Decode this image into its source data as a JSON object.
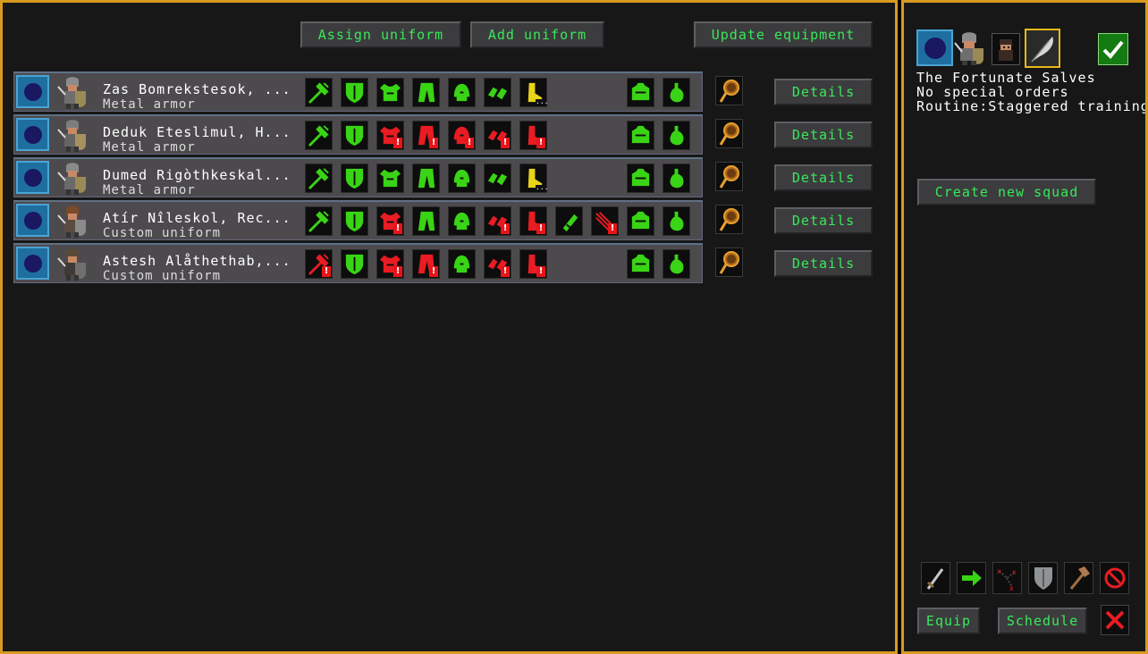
{
  "toolbar": {
    "assign_label": "Assign uniform",
    "add_label": "Add uniform",
    "update_label": "Update equipment"
  },
  "soldiers": [
    {
      "name": "Zas Bomrekstesok, ...",
      "uniform": "Metal armor",
      "details_label": "Details",
      "slots": [
        "weapon-ok",
        "shield-ok",
        "armor-ok",
        "legs-ok",
        "helm-ok",
        "gloves-ok",
        "boots-partial",
        "",
        "",
        "armor-ok",
        "flask-ok"
      ]
    },
    {
      "name": "Deduk Eteslimul, H...",
      "uniform": "Metal armor",
      "details_label": "Details",
      "slots": [
        "weapon-ok",
        "shield-ok",
        "armor-missing",
        "legs-missing",
        "helm-missing",
        "gloves-missing",
        "boots-missing",
        "",
        "",
        "armor-ok",
        "flask-ok"
      ]
    },
    {
      "name": "Dumed Rigòthkeskal...",
      "uniform": "Metal armor",
      "details_label": "Details",
      "slots": [
        "weapon-ok",
        "shield-ok",
        "armor-ok",
        "legs-ok",
        "helm-ok",
        "gloves-ok",
        "boots-partial",
        "",
        "",
        "armor-ok",
        "flask-ok"
      ]
    },
    {
      "name": "Atír Nîleskol, Rec...",
      "uniform": "Custom uniform",
      "details_label": "Details",
      "slots": [
        "weapon-ok",
        "shield-ok",
        "armor-missing",
        "legs-ok",
        "helm-ok",
        "gloves-missing",
        "boots-missing",
        "quiver-ok",
        "bolts-missing",
        "armor-ok",
        "flask-ok"
      ]
    },
    {
      "name": "Astesh Alåthethab,...",
      "uniform": "Custom uniform",
      "details_label": "Details",
      "slots": [
        "weapon-missing",
        "shield-ok",
        "armor-missing",
        "legs-missing",
        "helm-ok",
        "gloves-missing",
        "boots-missing",
        "",
        "",
        "armor-ok",
        "flask-ok"
      ]
    }
  ],
  "squad": {
    "name": "The Fortunate Salves",
    "orders": "No special orders",
    "routine": "Routine:Staggered training",
    "create_label": "Create new squad",
    "equip_label": "Equip",
    "schedule_label": "Schedule"
  },
  "colors": {
    "ok": "#39d415",
    "missing": "#e81c22",
    "partial": "#e8d418",
    "accent": "#39e85a",
    "frame": "#d99a22"
  },
  "icons": [
    "weapon-icon",
    "shield-icon",
    "armor-icon",
    "legs-icon",
    "helm-icon",
    "gloves-icon",
    "boots-icon",
    "quiver-icon",
    "bolts-icon",
    "backpack-icon",
    "flask-icon",
    "magnifier-icon",
    "sword-icon",
    "arrow-icon",
    "patrol-icon",
    "defend-icon",
    "hammer-icon",
    "cancel-icon",
    "checkmark-icon",
    "close-icon"
  ]
}
